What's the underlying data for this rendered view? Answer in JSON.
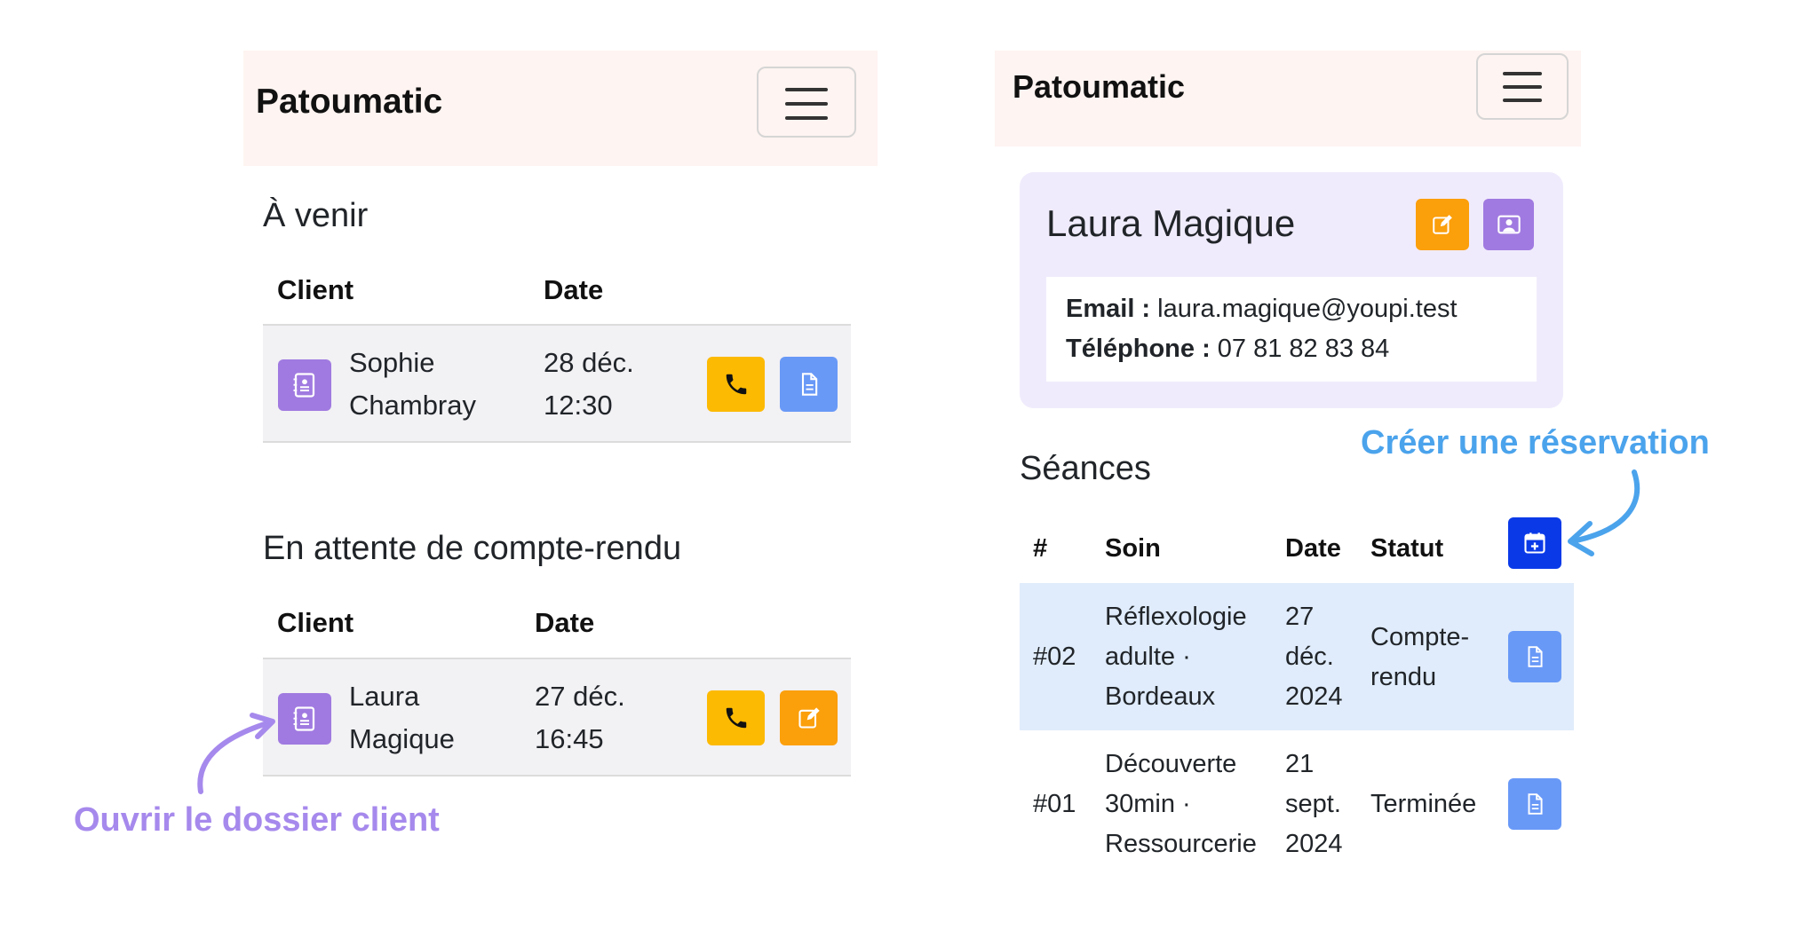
{
  "colors": {
    "navbar_bg": "#fef4f1",
    "purple_button": "#a07ae0",
    "yellow_button": "#fcba03",
    "orange_button": "#fb9f0b",
    "blue_button": "#6999f7",
    "navy_button": "#0a3ae8",
    "annotation_purple": "#a689ec",
    "annotation_blue": "#4ba3ec"
  },
  "left_screen": {
    "navbar": {
      "brand": "Patoumatic",
      "menu_icon": "hamburger-icon"
    },
    "upcoming": {
      "title": "À venir",
      "headers": {
        "client": "Client",
        "date": "Date"
      },
      "rows": [
        {
          "client_line1": "Sophie",
          "client_line2": "Chambray",
          "date_line1": "28 déc.",
          "date_line2": "12:30"
        }
      ]
    },
    "pending": {
      "title": "En attente de compte-rendu",
      "headers": {
        "client": "Client",
        "date": "Date"
      },
      "rows": [
        {
          "client_line1": "Laura",
          "client_line2": "Magique",
          "date_line1": "27 déc.",
          "date_line2": "16:45"
        }
      ]
    },
    "annotation": "Ouvrir le dossier client"
  },
  "right_screen": {
    "navbar": {
      "brand": "Patoumatic",
      "menu_icon": "hamburger-icon"
    },
    "client": {
      "name": "Laura Magique",
      "email_label": "Email :",
      "email": "laura.magique@youpi.test",
      "phone_label": "Téléphone :",
      "phone": "07 81 82 83 84"
    },
    "seances": {
      "title": "Séances",
      "headers": {
        "num": "#",
        "soin": "Soin",
        "date": "Date",
        "statut": "Statut"
      },
      "rows": [
        {
          "num": "#02",
          "soin": [
            "Réflexologie",
            "adulte ·",
            "Bordeaux"
          ],
          "date": [
            "27",
            "déc.",
            "2024"
          ],
          "statut": [
            "Compte-",
            "rendu"
          ]
        },
        {
          "num": "#01",
          "soin": [
            "Découverte",
            "30min ·",
            "Ressourcerie"
          ],
          "date": [
            "21",
            "sept.",
            "2024"
          ],
          "statut": [
            "Terminée"
          ]
        }
      ]
    },
    "annotation": "Créer une réservation"
  }
}
